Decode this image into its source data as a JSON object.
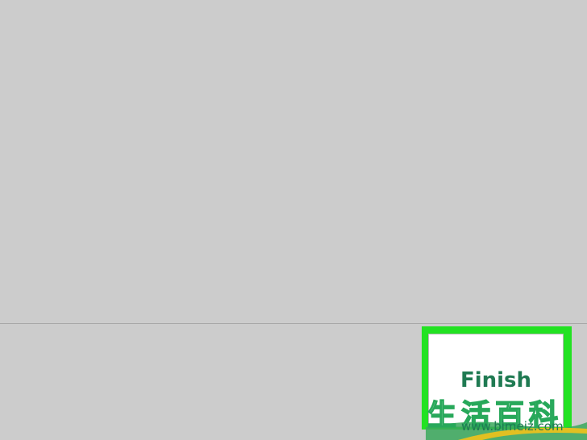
{
  "dialog": {
    "finish_label": "Finish"
  },
  "watermark": {
    "chinese_text": "生活百科",
    "url": "www.bimeiz.com"
  },
  "colors": {
    "highlight": "#22e222",
    "button_text": "#1f7a52",
    "background": "#cccccc"
  }
}
